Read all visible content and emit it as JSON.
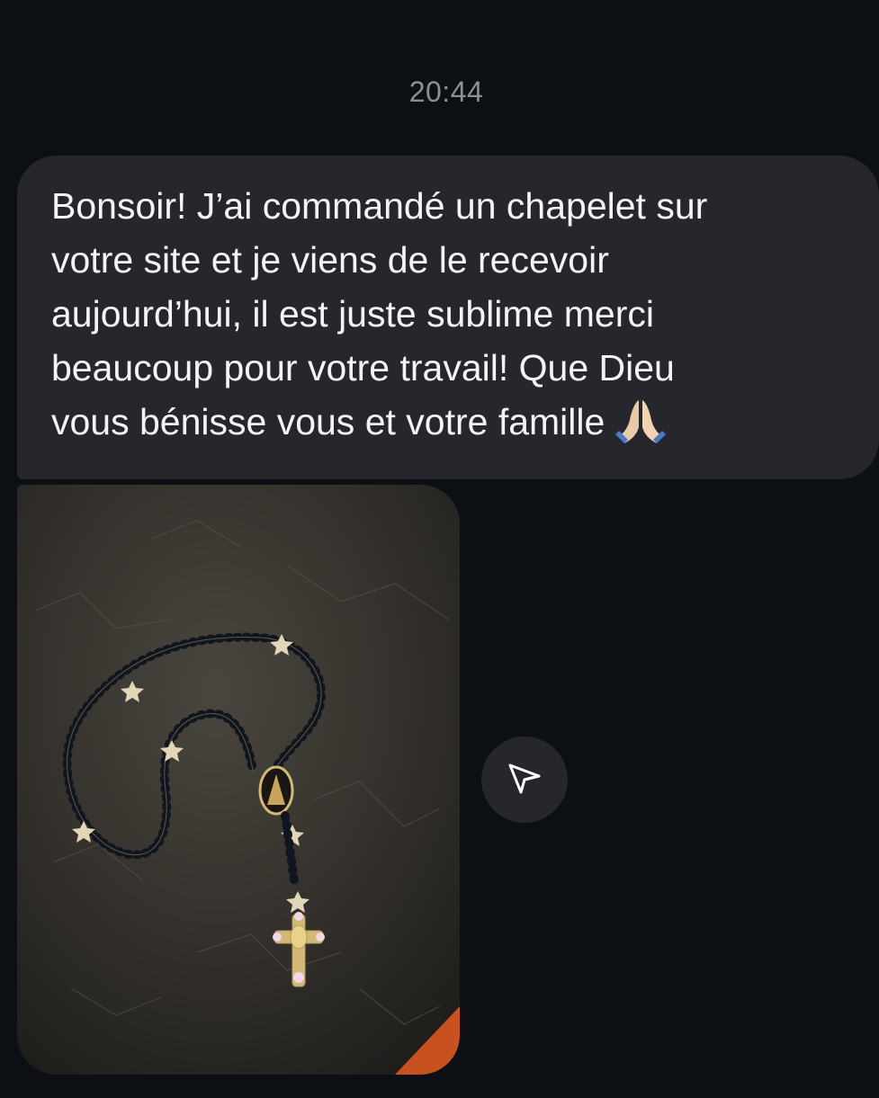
{
  "conversation": {
    "timestamp": "20:44",
    "message": {
      "text": "Bonsoir! J’ai commandé un chapelet sur\nvotre site et je viens de le recevoir\naujourd’hui, il est juste sublime merci\nbeaucoup pour votre travail! Que Dieu\nvous bénisse vous et votre famille",
      "emoji": "pray-icon"
    },
    "attachment": {
      "type": "photo",
      "subject": "rosary-photo"
    },
    "share_icon": "send-icon"
  },
  "colors": {
    "background": "#0c0f14",
    "bubble": "#25272c",
    "text": "#f3f4f6",
    "timestamp": "#8b8f96"
  }
}
